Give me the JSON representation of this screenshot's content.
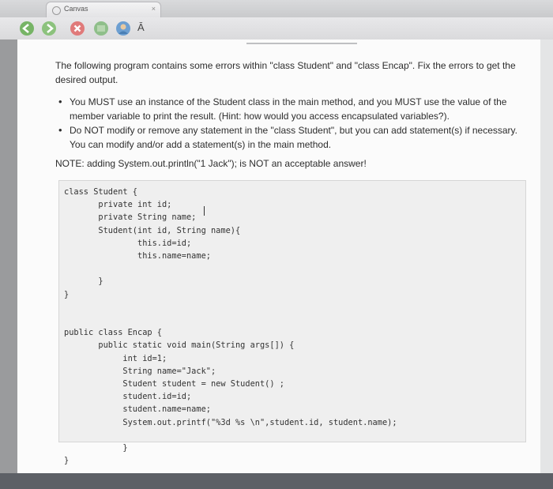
{
  "tab": {
    "title": "Canvas",
    "close": "×"
  },
  "toolbar": {
    "a_label": "Ā"
  },
  "question": {
    "intro": "The following program contains some errors within \"class Student\" and \"class Encap\". Fix the errors to get the desired output.",
    "bullets": [
      "You MUST use an instance of the Student class in the main method, and you MUST use the value of the member variable to print the result. (Hint: how would you access encapsulated variables?).",
      "Do NOT modify or remove any statement in the \"class Student\", but you can add statement(s) if necessary. You can modify and/or add a statement(s) in the main method."
    ],
    "note": "NOTE: adding System.out.println(\"1 Jack\"); is NOT an acceptable answer!"
  },
  "code": {
    "lines": [
      "class Student {",
      "       private int id;",
      "       private String name;",
      "       Student(int id, String name){",
      "               this.id=id;",
      "               this.name=name;",
      "",
      "       }",
      "}",
      "",
      "",
      "public class Encap {",
      "       public static void main(String args[]) {",
      "            int id=1;",
      "            String name=\"Jack\";",
      "            Student student = new Student() ;",
      "            student.id=id;",
      "            student.name=name;",
      "            System.out.printf(\"%3d %s \\n\",student.id, student.name);",
      "",
      "            }",
      "}"
    ]
  },
  "colors": {
    "page": "#fbfbfb",
    "codebox": "#efefef",
    "text": "#2d2d2d"
  },
  "icons": [
    "back-icon",
    "forward-icon",
    "close-icon",
    "extension-icon",
    "globe-icon"
  ]
}
